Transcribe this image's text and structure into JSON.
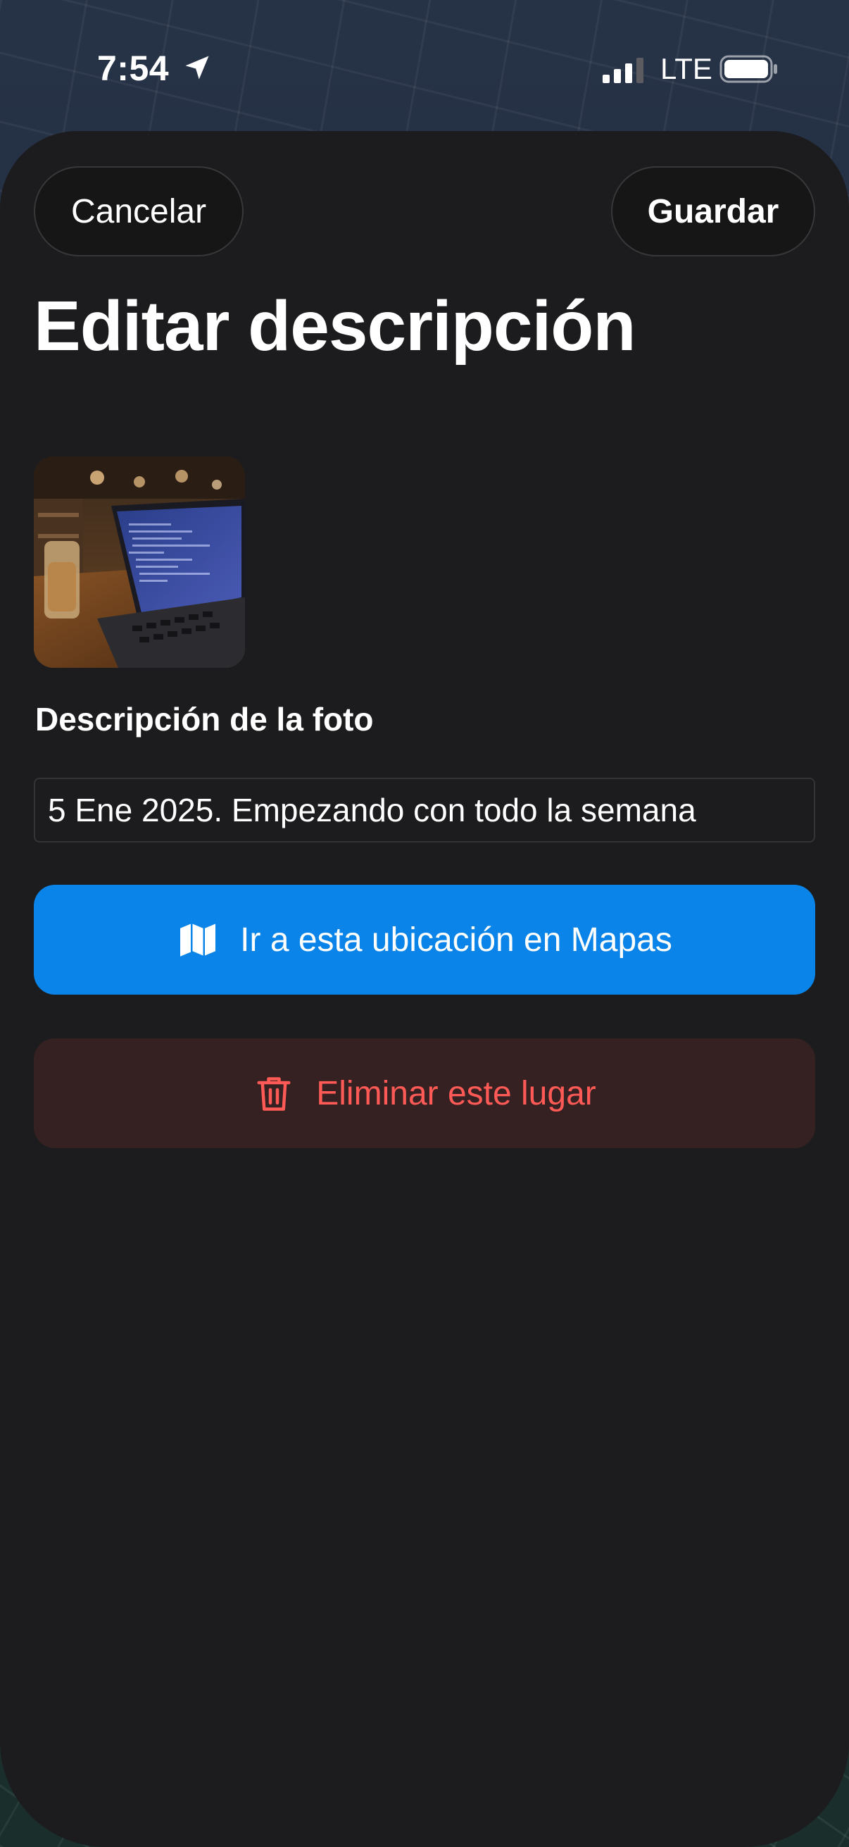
{
  "status_bar": {
    "time": "7:54",
    "network": "LTE",
    "icons": [
      "location-arrow-icon",
      "cellular-signal-icon",
      "battery-icon"
    ]
  },
  "header": {
    "cancel_label": "Cancelar",
    "save_label": "Guardar",
    "title": "Editar descripción"
  },
  "photo": {
    "description": "Café scene with a laptop showing code and an iced drink on a wooden table"
  },
  "form": {
    "label": "Descripción de la foto",
    "value": "5 Ene 2025. Empezando con todo la semana"
  },
  "actions": {
    "maps_label": "Ir a esta ubicación en Mapas",
    "maps_icon": "map-icon",
    "delete_label": "Eliminar este lugar",
    "delete_icon": "trash-icon"
  },
  "colors": {
    "sheet_background": "#1c1c1e",
    "primary_blue": "#0a84e8",
    "destructive_red": "#ff5a55",
    "destructive_background": "#352022"
  }
}
